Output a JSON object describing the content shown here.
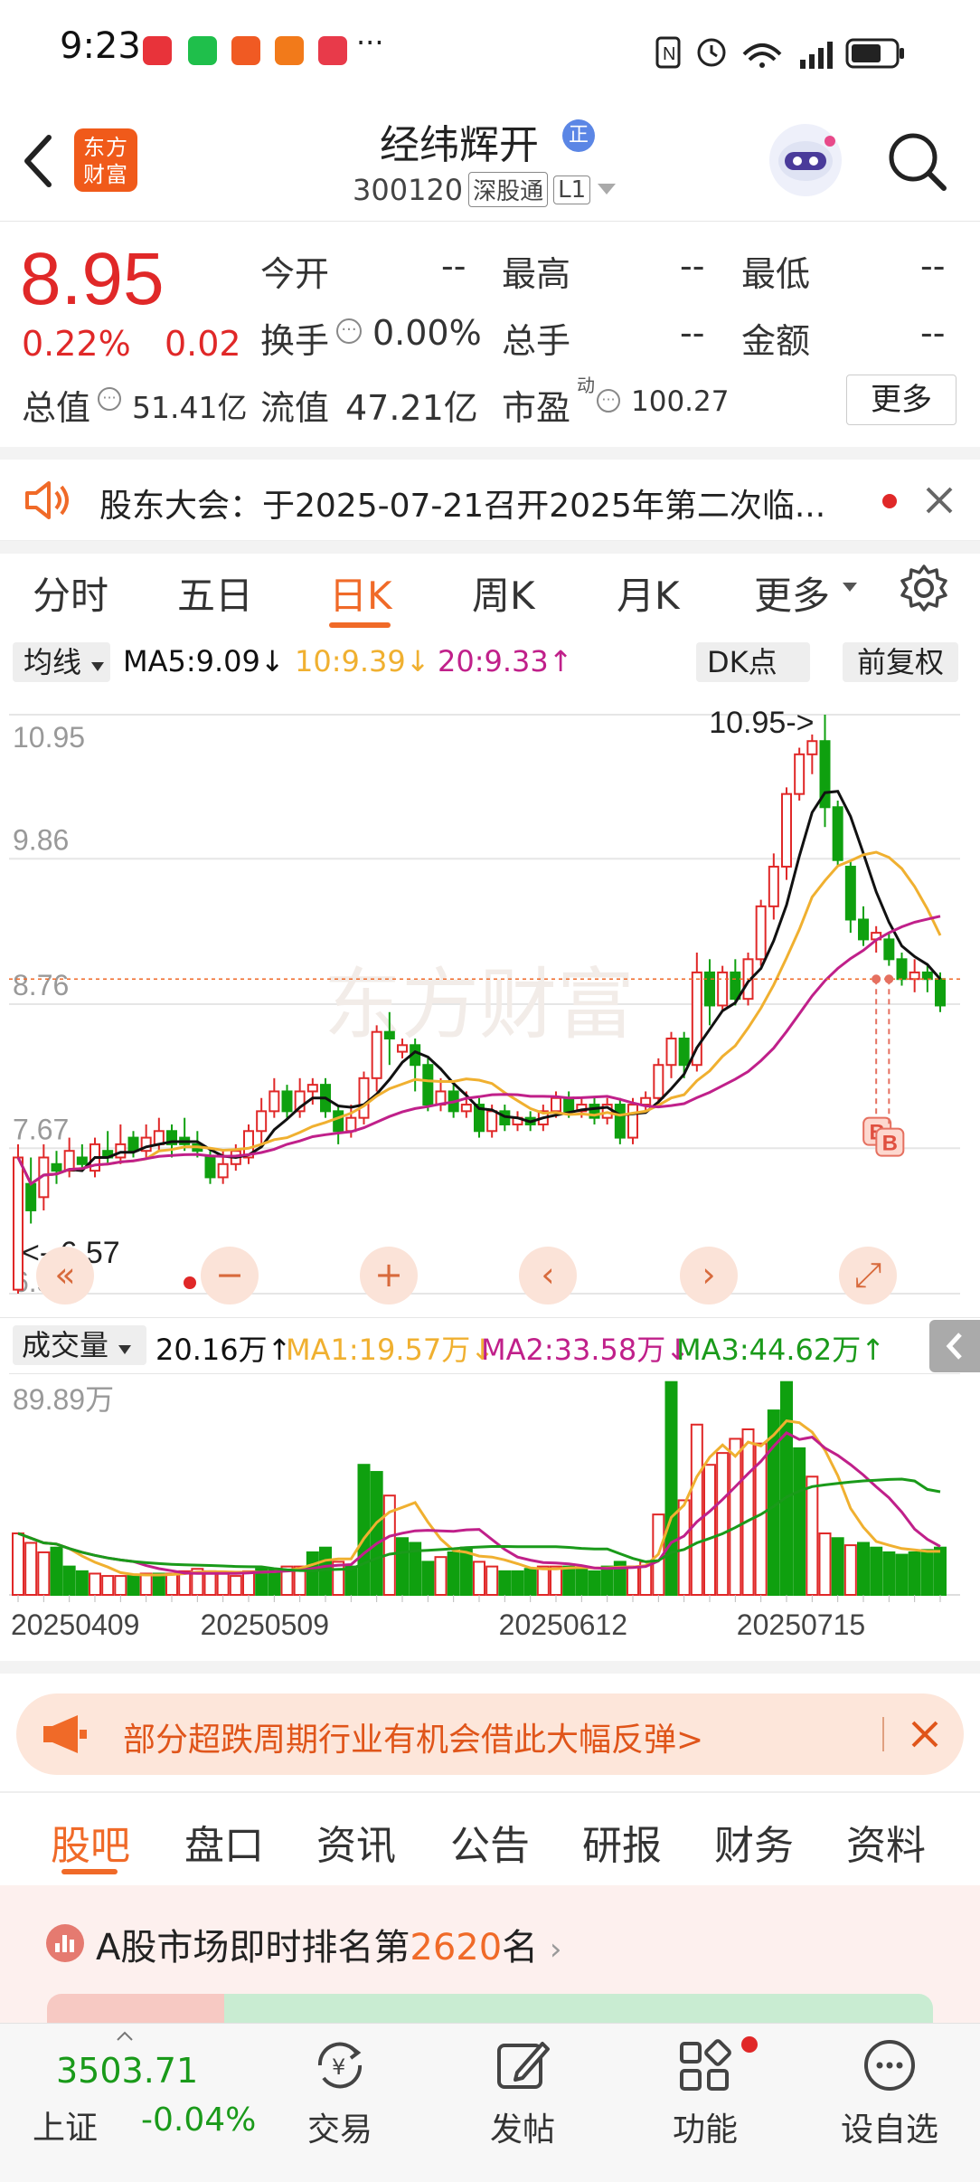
{
  "status_bar": {
    "time": "9:23",
    "more": "···"
  },
  "header": {
    "logo_text": "东方财富",
    "title": "经纬辉开",
    "badge": "正",
    "code": "300120",
    "market_tag": "深股通",
    "level_tag": "L1"
  },
  "quote": {
    "price": "8.95",
    "change_pct": "0.22%",
    "change": "0.02",
    "fields": [
      {
        "label": "今开",
        "value": "--"
      },
      {
        "label": "最高",
        "value": "--"
      },
      {
        "label": "最低",
        "value": "--"
      },
      {
        "label": "换手",
        "value": "0.00%"
      },
      {
        "label": "总手",
        "value": "--"
      },
      {
        "label": "金额",
        "value": "--"
      },
      {
        "label": "总值",
        "value": "51.41亿"
      },
      {
        "label": "流值",
        "value": "47.21亿"
      },
      {
        "label": "市盈",
        "sup": "动",
        "value": "100.27"
      }
    ],
    "more_button": "更多"
  },
  "notice": {
    "text": "股东大会：于2025-07-21召开2025年第二次临..."
  },
  "chart_tabs": [
    "分时",
    "五日",
    "日K",
    "周K",
    "月K",
    "更多"
  ],
  "active_tab": "日K",
  "indicators": {
    "selector": "均线",
    "ma5": "MA5:9.09",
    "ma10": "10:9.39",
    "ma20": "20:9.33",
    "dk_button": "DK点",
    "adjust_button": "前复权"
  },
  "chart_data": [
    {
      "type": "candlestick",
      "title": "日K",
      "y_ticks": [
        "10.95",
        "9.86",
        "8.76",
        "7.67",
        "6.57"
      ],
      "ylim": [
        6.57,
        10.95
      ],
      "high_annotation": "10.95->",
      "low_annotation": "<--6.57",
      "last_price": 8.95,
      "watermark": "东方财富",
      "markers": [
        "B",
        "B"
      ],
      "series": [
        {
          "name": "MA5",
          "color": "#111111"
        },
        {
          "name": "MA10",
          "color": "#f0b030"
        },
        {
          "name": "MA20",
          "color": "#c0208a"
        }
      ],
      "candles": [
        [
          6.6,
          7.6,
          6.57,
          7.7
        ],
        [
          7.4,
          7.2,
          7.1,
          7.6
        ],
        [
          7.3,
          7.6,
          7.2,
          7.7
        ],
        [
          7.55,
          7.5,
          7.4,
          7.65
        ],
        [
          7.5,
          7.65,
          7.45,
          7.75
        ],
        [
          7.6,
          7.55,
          7.5,
          7.7
        ],
        [
          7.5,
          7.7,
          7.45,
          7.75
        ],
        [
          7.65,
          7.6,
          7.55,
          7.8
        ],
        [
          7.6,
          7.7,
          7.55,
          7.85
        ],
        [
          7.75,
          7.65,
          7.6,
          7.8
        ],
        [
          7.65,
          7.75,
          7.6,
          7.85
        ],
        [
          7.7,
          7.8,
          7.65,
          7.9
        ],
        [
          7.8,
          7.7,
          7.6,
          7.85
        ],
        [
          7.75,
          7.7,
          7.65,
          7.9
        ],
        [
          7.7,
          7.65,
          7.6,
          7.8
        ],
        [
          7.6,
          7.45,
          7.4,
          7.65
        ],
        [
          7.45,
          7.55,
          7.4,
          7.65
        ],
        [
          7.55,
          7.65,
          7.5,
          7.7
        ],
        [
          7.6,
          7.8,
          7.55,
          7.85
        ],
        [
          7.8,
          7.95,
          7.7,
          8.05
        ],
        [
          7.95,
          8.1,
          7.9,
          8.2
        ],
        [
          8.1,
          7.95,
          7.9,
          8.15
        ],
        [
          7.95,
          8.1,
          7.9,
          8.2
        ],
        [
          8.1,
          8.15,
          8.0,
          8.2
        ],
        [
          8.15,
          7.95,
          7.9,
          8.2
        ],
        [
          7.95,
          7.8,
          7.7,
          8.0
        ],
        [
          7.8,
          7.9,
          7.75,
          8.0
        ],
        [
          7.9,
          8.2,
          7.85,
          8.25
        ],
        [
          8.2,
          8.55,
          8.1,
          8.6
        ],
        [
          8.55,
          8.5,
          8.3,
          8.7
        ],
        [
          8.4,
          8.45,
          8.35,
          8.5
        ],
        [
          8.45,
          8.3,
          8.1,
          8.5
        ],
        [
          8.3,
          8.0,
          7.95,
          8.35
        ],
        [
          8.0,
          8.1,
          7.95,
          8.2
        ],
        [
          8.1,
          7.95,
          7.9,
          8.15
        ],
        [
          7.95,
          8.0,
          7.9,
          8.1
        ],
        [
          8.0,
          7.8,
          7.75,
          8.05
        ],
        [
          7.8,
          7.95,
          7.75,
          8.0
        ],
        [
          7.95,
          7.85,
          7.8,
          8.0
        ],
        [
          7.85,
          7.9,
          7.8,
          7.95
        ],
        [
          7.9,
          7.85,
          7.8,
          7.95
        ],
        [
          7.85,
          7.95,
          7.8,
          8.0
        ],
        [
          7.95,
          8.05,
          7.9,
          8.1
        ],
        [
          8.05,
          7.95,
          7.9,
          8.1
        ],
        [
          7.95,
          8.0,
          7.9,
          8.05
        ],
        [
          8.0,
          7.9,
          7.85,
          8.05
        ],
        [
          7.9,
          8.0,
          7.85,
          8.05
        ],
        [
          8.0,
          7.75,
          7.7,
          8.05
        ],
        [
          7.75,
          8.0,
          7.7,
          8.05
        ],
        [
          8.0,
          8.05,
          7.95,
          8.1
        ],
        [
          8.05,
          8.3,
          8.0,
          8.35
        ],
        [
          8.3,
          8.5,
          8.2,
          8.55
        ],
        [
          8.5,
          8.3,
          8.2,
          8.55
        ],
        [
          8.3,
          9.0,
          8.25,
          9.15
        ],
        [
          9.0,
          8.75,
          8.6,
          9.1
        ],
        [
          8.75,
          9.0,
          8.7,
          9.05
        ],
        [
          9.0,
          8.8,
          8.75,
          9.1
        ],
        [
          8.8,
          9.1,
          8.75,
          9.15
        ],
        [
          9.1,
          9.5,
          9.05,
          9.55
        ],
        [
          9.5,
          9.8,
          9.4,
          9.9
        ],
        [
          9.8,
          10.35,
          9.7,
          10.4
        ],
        [
          10.35,
          10.65,
          10.3,
          10.7
        ],
        [
          10.65,
          10.75,
          10.5,
          10.8
        ],
        [
          10.75,
          10.25,
          10.1,
          10.95
        ],
        [
          10.25,
          9.85,
          9.8,
          10.3
        ],
        [
          9.8,
          9.4,
          9.3,
          9.85
        ],
        [
          9.4,
          9.25,
          9.2,
          9.5
        ],
        [
          9.25,
          9.3,
          9.15,
          9.35
        ],
        [
          9.25,
          9.1,
          9.05,
          9.3
        ],
        [
          9.1,
          8.95,
          8.9,
          9.15
        ],
        [
          8.95,
          9.0,
          8.85,
          9.1
        ],
        [
          9.0,
          8.95,
          8.85,
          9.05
        ],
        [
          8.95,
          8.75,
          8.7,
          9.0
        ]
      ]
    },
    {
      "type": "bar",
      "title": "成交量",
      "y_ticks": [
        "89.89万"
      ],
      "ylim": [
        0,
        89.89
      ],
      "latest": "20.16万",
      "ma1": "MA1:19.57万",
      "ma2": "MA2:33.58万",
      "ma3": "MA3:44.62万",
      "x_ticks": [
        "20250409",
        "20250509",
        "20250612",
        "20250715"
      ],
      "values": [
        26,
        22,
        18,
        20,
        12,
        10,
        9,
        8,
        8,
        8,
        9,
        9,
        9,
        10,
        11,
        10,
        9,
        8,
        10,
        11,
        11,
        12,
        12,
        18,
        20,
        14,
        12,
        55,
        52,
        42,
        24,
        22,
        14,
        16,
        18,
        20,
        14,
        12,
        10,
        10,
        11,
        12,
        12,
        12,
        11,
        10,
        12,
        14,
        12,
        14,
        34,
        90,
        40,
        72,
        55,
        60,
        66,
        70,
        64,
        78,
        90,
        62,
        50,
        26,
        24,
        21,
        22,
        20,
        18,
        17,
        18,
        19,
        20
      ],
      "colors": "rrrgggrrrgrgrrrrrrrggrrggrgggrgggrggrrgggrrgggggrrrgrrrrrrrgggrrgrggggg"
    }
  ],
  "chart_controls": [
    "«",
    "−",
    "+",
    "‹",
    "›",
    "⤢"
  ],
  "volume_selector": "成交量",
  "banner": {
    "text": "部分超跌周期行业有机会借此大幅反弹>"
  },
  "section_tabs": [
    "股吧",
    "盘口",
    "资讯",
    "公告",
    "研报",
    "财务",
    "资料"
  ],
  "active_section": "股吧",
  "ranking": {
    "prefix": "A股市场即时排名第",
    "rank": "2620",
    "suffix": "名"
  },
  "bottom_nav": {
    "index_value": "3503.71",
    "index_name": "上证",
    "index_change": "-0.04%",
    "items": [
      "交易",
      "发帖",
      "功能",
      "设自选"
    ]
  },
  "colors": {
    "up": "#e02828",
    "down": "#0fa00f",
    "accent": "#f06a28",
    "ma5": "#111111",
    "ma10": "#f0b030",
    "ma20": "#c0208a"
  }
}
